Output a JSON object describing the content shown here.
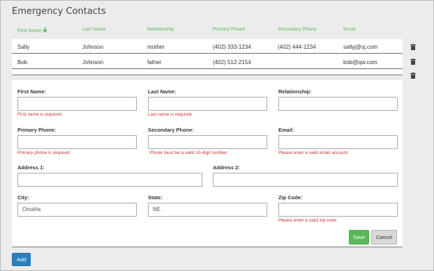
{
  "page": {
    "title": "Emergency Contacts"
  },
  "table": {
    "columns": [
      "First Name",
      "Last Name",
      "Relationship",
      "Primary Phone",
      "Secondary Phone",
      "Email"
    ],
    "rows": [
      [
        "Sally",
        "Johnson",
        "mother",
        "(402) 333-1234",
        "(402) 444-1234",
        "sallyj@sj.com"
      ],
      [
        "Bob",
        "Johnson",
        "father",
        "(402) 512-2154",
        "",
        "bob@qw.com"
      ]
    ]
  },
  "form": {
    "first_name": {
      "label": "First Name:",
      "value": "",
      "error": "First name is required."
    },
    "last_name": {
      "label": "Last Name:",
      "value": "",
      "error": "Last name is required."
    },
    "relationship": {
      "label": "Relationship:",
      "value": ""
    },
    "primary_phone": {
      "label": "Primary Phone:",
      "value": "",
      "error": "Primary phone is required."
    },
    "secondary_phone": {
      "label": "Secondary Phone:",
      "value": "",
      "error": "Phone must be a valid 10-digit number."
    },
    "email": {
      "label": "Email:",
      "value": "",
      "error": "Please enter a valid email account."
    },
    "address1": {
      "label": "Address 1:",
      "value": ""
    },
    "address2": {
      "label": "Address 2:",
      "value": ""
    },
    "city": {
      "label": "City:",
      "value": "Omaha"
    },
    "state": {
      "label": "State:",
      "value": "NE"
    },
    "zip": {
      "label": "Zip Code:",
      "value": "",
      "error": "Please enter a valid zip code."
    }
  },
  "buttons": {
    "save": "Save",
    "cancel": "Cancel",
    "add": "Add"
  },
  "colors": {
    "header_text": "#5cb85c",
    "error": "#c9302c",
    "save": "#5cb85c",
    "add": "#2b7fbd"
  },
  "icons": {
    "sort": "arrow-down-icon",
    "delete": "trash-icon"
  }
}
